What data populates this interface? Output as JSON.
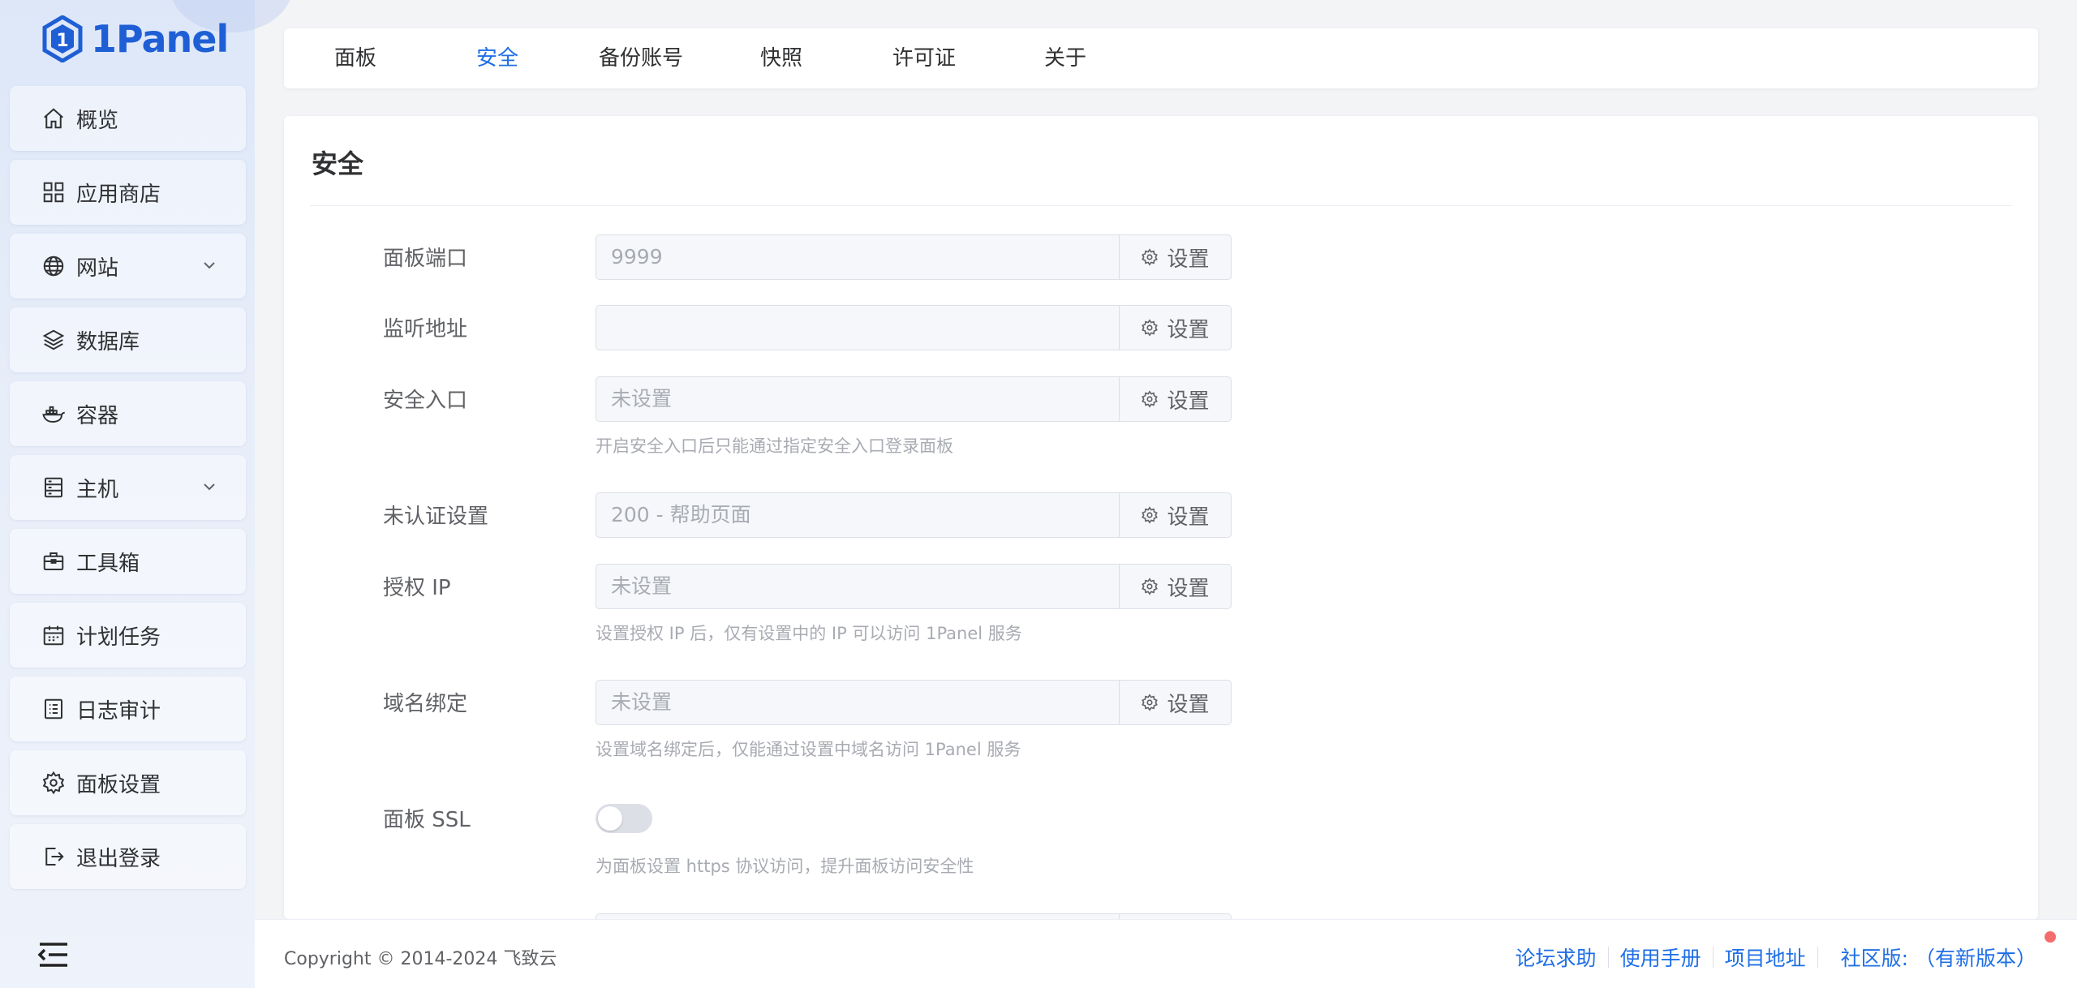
{
  "app": {
    "name": "1Panel",
    "brand_color": "#1f5fd6",
    "accent_color": "#1f6fe5"
  },
  "sidebar": {
    "items": [
      {
        "label": "概览",
        "icon": "home-icon"
      },
      {
        "label": "应用商店",
        "icon": "grid-icon"
      },
      {
        "label": "网站",
        "icon": "globe-icon",
        "expandable": true
      },
      {
        "label": "数据库",
        "icon": "layers-icon"
      },
      {
        "label": "容器",
        "icon": "docker-icon"
      },
      {
        "label": "主机",
        "icon": "server-icon",
        "expandable": true
      },
      {
        "label": "工具箱",
        "icon": "toolbox-icon"
      },
      {
        "label": "计划任务",
        "icon": "calendar-icon"
      },
      {
        "label": "日志审计",
        "icon": "log-icon"
      },
      {
        "label": "面板设置",
        "icon": "gear-icon"
      },
      {
        "label": "退出登录",
        "icon": "logout-icon"
      }
    ]
  },
  "tabs": [
    {
      "label": "面板",
      "active": false
    },
    {
      "label": "安全",
      "active": true
    },
    {
      "label": "备份账号",
      "active": false
    },
    {
      "label": "快照",
      "active": false
    },
    {
      "label": "许可证",
      "active": false
    },
    {
      "label": "关于",
      "active": false
    }
  ],
  "security": {
    "title": "安全",
    "button_label": "设置",
    "rows": [
      {
        "label": "面板端口",
        "value": "9999",
        "help": ""
      },
      {
        "label": "监听地址",
        "value": "",
        "help": ""
      },
      {
        "label": "安全入口",
        "value": "未设置",
        "help": "开启安全入口后只能通过指定安全入口登录面板"
      },
      {
        "label": "未认证设置",
        "value": "200 - 帮助页面",
        "help": ""
      },
      {
        "label": "授权 IP",
        "value": "未设置",
        "help": "设置授权 IP 后，仅有设置中的 IP 可以访问 1Panel 服务"
      },
      {
        "label": "域名绑定",
        "value": "未设置",
        "help": "设置域名绑定后，仅能通过设置中域名访问 1Panel 服务"
      }
    ],
    "ssl": {
      "label": "面板 SSL",
      "enabled": false,
      "help": "为面板设置 https 协议访问，提升面板访问安全性"
    }
  },
  "footer": {
    "copyright": "Copyright © 2014-2024 飞致云",
    "links": [
      "论坛求助",
      "使用手册",
      "项目地址"
    ],
    "edition": "社区版:",
    "update_notice": "（有新版本）"
  }
}
